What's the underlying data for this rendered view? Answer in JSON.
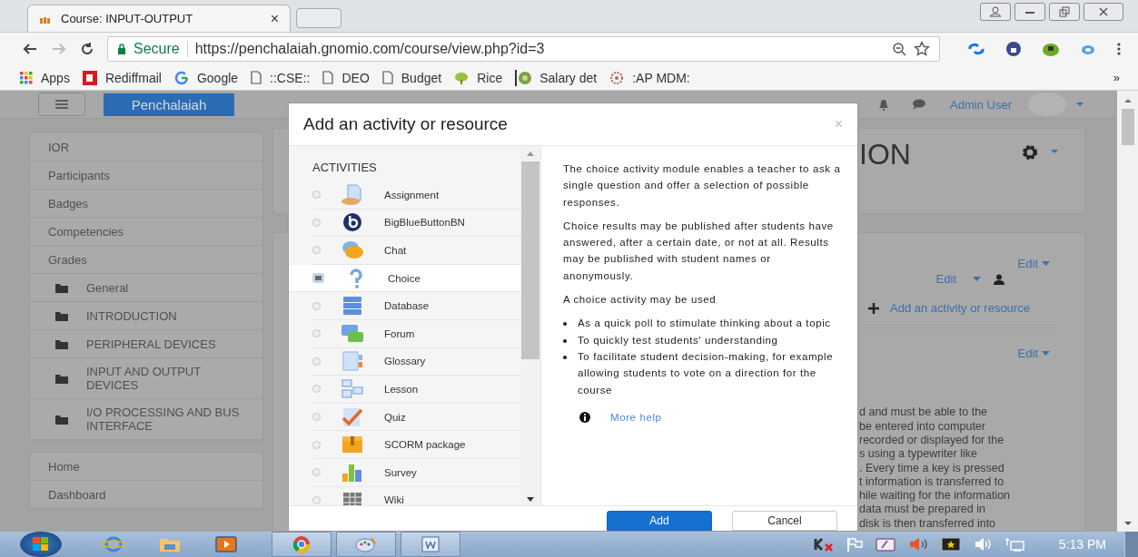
{
  "browser": {
    "tab": {
      "title": "Course: INPUT-OUTPUT",
      "close": "×"
    },
    "address": {
      "secure_label": "Secure",
      "url": "https://penchalaiah.gnomio.com/course/view.php?id=3"
    },
    "bookmarks": [
      {
        "label": "Apps",
        "kind": "apps"
      },
      {
        "label": "Rediffmail",
        "kind": "rediff"
      },
      {
        "label": "Google",
        "kind": "google"
      },
      {
        "label": "::CSE::",
        "kind": "page"
      },
      {
        "label": "DEO",
        "kind": "page"
      },
      {
        "label": "Budget",
        "kind": "page"
      },
      {
        "label": "Rice",
        "kind": "plant"
      },
      {
        "label": "Salary det",
        "kind": "seal"
      },
      {
        "label": ":AP MDM:",
        "kind": "emblem"
      }
    ],
    "bookmarks_more": "»"
  },
  "navbar": {
    "brand": "Penchalaiah",
    "user": "Admin User"
  },
  "sidebar": {
    "groups": [
      {
        "items": [
          {
            "label": "IOR",
            "kind": "link"
          },
          {
            "label": "Participants",
            "kind": "link"
          },
          {
            "label": "Badges",
            "kind": "link"
          },
          {
            "label": "Competencies",
            "kind": "link"
          },
          {
            "label": "Grades",
            "kind": "link"
          },
          {
            "label": "General",
            "kind": "section"
          },
          {
            "label": "INTRODUCTION",
            "kind": "section"
          },
          {
            "label": "PERIPHERAL DEVICES",
            "kind": "section"
          },
          {
            "label": "INPUT AND OUTPUT DEVICES",
            "kind": "section"
          },
          {
            "label": "I/O PROCESSING AND BUS INTERFACE",
            "kind": "section"
          }
        ]
      },
      {
        "items": [
          {
            "label": "Home",
            "kind": "link"
          },
          {
            "label": "Dashboard",
            "kind": "link"
          }
        ]
      }
    ]
  },
  "course": {
    "title": "ION"
  },
  "section": {
    "top_edit": "Edit",
    "activity_edit": "Edit",
    "add_activity": "Add an activity or resource",
    "section_edit": "Edit",
    "text_lines": [
      "d and must be able to the",
      "be entered into computer",
      "recorded or displayed for the",
      "s using a typewriter like",
      ". Every time a key is pressed",
      "t information is transferred to",
      "hile waiting for the information",
      "data must be prepared in",
      "disk is then transferred into"
    ]
  },
  "modal": {
    "title": "Add an activity or resource",
    "close": "×",
    "list_heading": "ACTIVITIES",
    "items": [
      {
        "label": "Assignment",
        "selected": false
      },
      {
        "label": "BigBlueButtonBN",
        "selected": false
      },
      {
        "label": "Chat",
        "selected": false
      },
      {
        "label": "Choice",
        "selected": true
      },
      {
        "label": "Database",
        "selected": false
      },
      {
        "label": "Forum",
        "selected": false
      },
      {
        "label": "Glossary",
        "selected": false
      },
      {
        "label": "Lesson",
        "selected": false
      },
      {
        "label": "Quiz",
        "selected": false
      },
      {
        "label": "SCORM package",
        "selected": false
      },
      {
        "label": "Survey",
        "selected": false
      },
      {
        "label": "Wiki",
        "selected": false
      }
    ],
    "description": {
      "paragraphs": [
        "The choice activity module enables a teacher to ask a single question and offer a selection of possible responses.",
        "Choice results may be published after students have answered, after a certain date, or not at all. Results may be published with student names or anonymously.",
        "A choice activity may be used"
      ],
      "bullets": [
        "As a quick poll to stimulate thinking about a topic",
        "To quickly test students' understanding",
        "To facilitate student decision-making, for example allowing students to vote on a direction for the course"
      ],
      "more_help": "More help"
    },
    "buttons": [
      {
        "label": "Add",
        "kind": "primary"
      },
      {
        "label": "Cancel",
        "kind": "secondary"
      }
    ]
  },
  "taskbar": {
    "clock": "5:13 PM"
  }
}
